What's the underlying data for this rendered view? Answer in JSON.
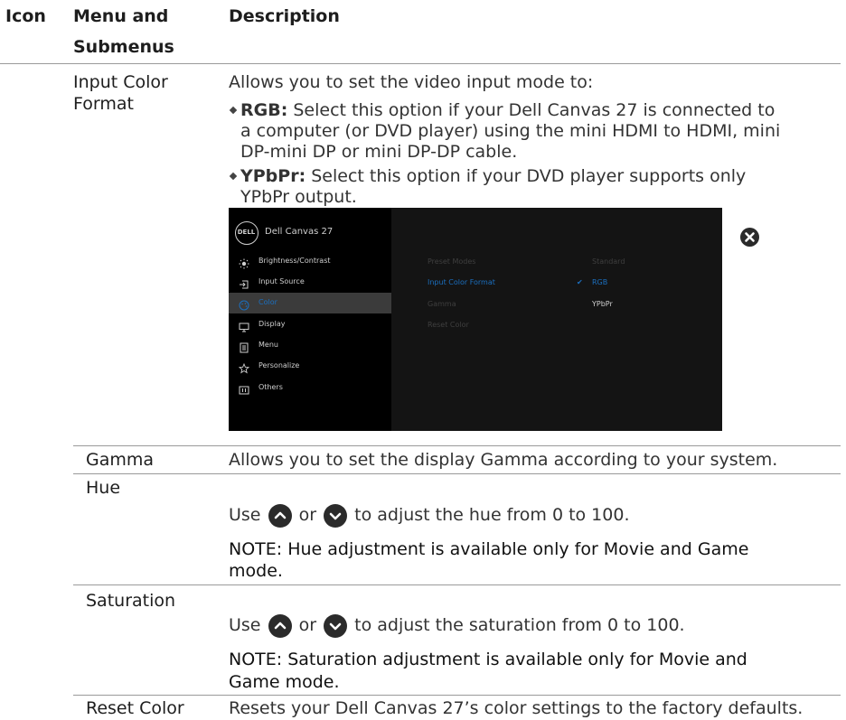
{
  "table": {
    "headers": {
      "icon": "Icon",
      "menu_line1": "Menu and",
      "menu_line2": "Submenus",
      "description": "Description"
    }
  },
  "rows": {
    "input_color_format": {
      "label_line1": "Input Color",
      "label_line2": "Format",
      "intro": "Allows you to set the video input mode to:",
      "rgb_term": "RGB:",
      "rgb_line1": " Select this option if your Dell Canvas 27 is connected to",
      "rgb_line2": "a computer (or DVD player) using the mini HDMI to HDMI, mini",
      "rgb_line3": "DP-mini DP or mini DP-DP cable.",
      "ypbpr_term": "YPbPr:",
      "ypbpr_line1": " Select this option if your DVD player supports only",
      "ypbpr_line2": "YPbPr output."
    },
    "gamma": {
      "label": "Gamma",
      "desc": "Allows you to set the display Gamma according to your system."
    },
    "hue": {
      "label": "Hue",
      "use": "Use",
      "or": "or",
      "desc_tail": "to adjust the hue from 0 to 100.",
      "note_line1": "NOTE: Hue adjustment is available only for Movie and Game",
      "note_line2": "mode."
    },
    "saturation": {
      "label": "Saturation",
      "use": "Use",
      "or": "or",
      "desc_tail": "to adjust the saturation from 0 to 100.",
      "note_line1": "NOTE: Saturation adjustment is available only for Movie and",
      "note_line2": "Game mode."
    },
    "reset_color": {
      "label": "Reset Color",
      "desc": "Resets your Dell Canvas 27’s color settings to the factory defaults."
    }
  },
  "osd": {
    "logo_text": "DELL",
    "title": "Dell Canvas 27",
    "menu": [
      {
        "label": "Brightness/Contrast",
        "icon": "sun-icon"
      },
      {
        "label": "Input Source",
        "icon": "input-source-icon"
      },
      {
        "label": "Color",
        "icon": "palette-icon",
        "selected": true
      },
      {
        "label": "Display",
        "icon": "monitor-icon"
      },
      {
        "label": "Menu",
        "icon": "menu-list-icon"
      },
      {
        "label": "Personalize",
        "icon": "star-icon"
      },
      {
        "label": "Others",
        "icon": "others-icon"
      }
    ],
    "submenu": [
      {
        "label": "Preset Modes",
        "value": "Standard"
      },
      {
        "label": "Input Color Format",
        "value": "RGB",
        "checked": true
      },
      {
        "label": "Gamma",
        "value": "YPbPr"
      },
      {
        "label": "Reset Color",
        "value": ""
      }
    ],
    "check_glyph": "✔",
    "colors": {
      "selected_bg": "#3b3b3b",
      "highlight_blue": "#1b6fbf"
    }
  }
}
